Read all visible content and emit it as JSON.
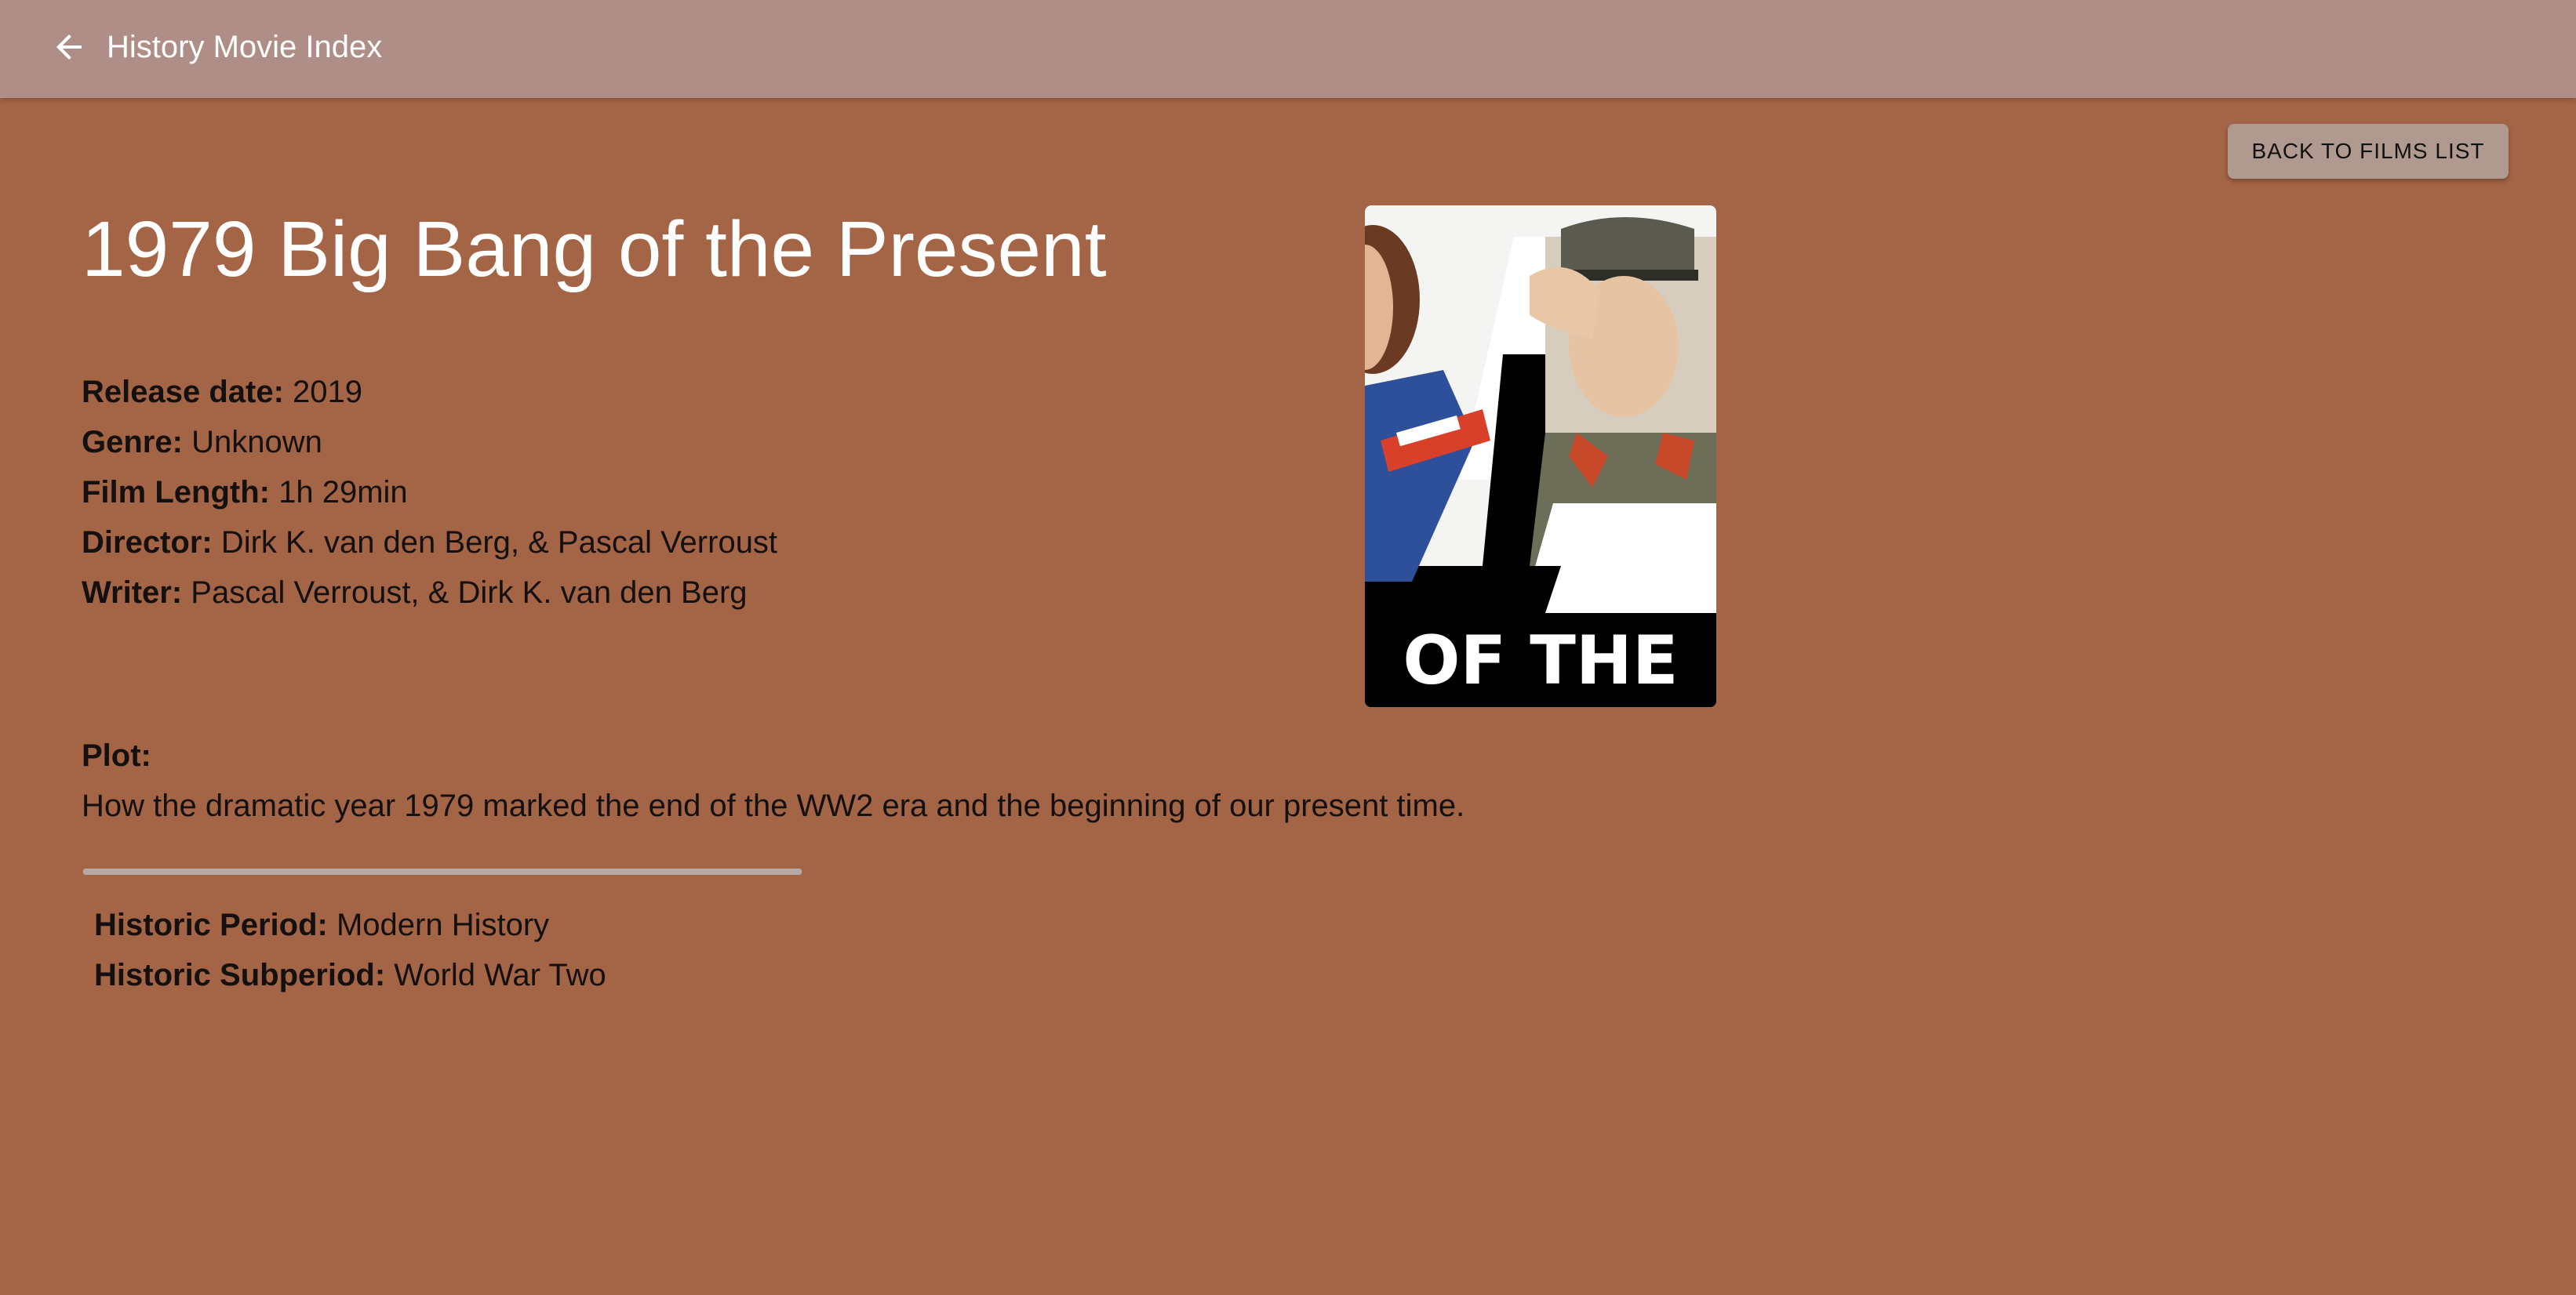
{
  "appbar": {
    "title": "History Movie Index",
    "back_icon": "arrow-left-icon"
  },
  "back_button_label": "BACK TO FILMS LIST",
  "movie": {
    "title": "1979 Big Bang of the Present",
    "release_date_label": "Release date:",
    "release_date": "2019",
    "genre_label": "Genre:",
    "genre": "Unknown",
    "length_label": "Film Length:",
    "length": "1h 29min",
    "director_label": "Director:",
    "director": "Dirk K. van den Berg, & Pascal Verroust",
    "writer_label": "Writer:",
    "writer": "Pascal Verroust, & Dirk K. van den Berg",
    "plot_label": "Plot:",
    "plot": "How the dramatic year 1979 marked the end of the WW2 era and the beginning of our present time.",
    "period_label": "Historic Period:",
    "period": "Modern History",
    "subperiod_label": "Historic Subperiod:",
    "subperiod": "World War Two"
  },
  "poster": {
    "visible_text": "OF THE"
  }
}
